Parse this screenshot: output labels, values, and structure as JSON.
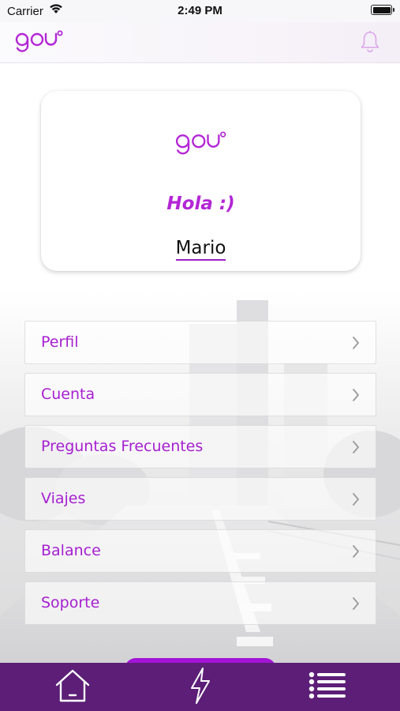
{
  "status_bar": {
    "carrier": "Carrier",
    "time": "2:49 PM"
  },
  "header": {
    "logo_text": "gou",
    "bell_icon": "bell-icon"
  },
  "card": {
    "logo_text": "gou",
    "greeting": "Hola :)",
    "user_name": "Mario"
  },
  "menu": {
    "items": [
      {
        "label": "Perfil"
      },
      {
        "label": "Cuenta"
      },
      {
        "label": "Preguntas Frecuentes"
      },
      {
        "label": "Viajes"
      },
      {
        "label": "Balance"
      },
      {
        "label": "Soporte"
      }
    ]
  },
  "tab_bar": {
    "tabs": [
      {
        "icon": "home-icon"
      },
      {
        "icon": "lightning-icon"
      },
      {
        "icon": "list-menu-icon"
      }
    ]
  },
  "colors": {
    "accent": "#a61fd0",
    "tab_bar": "#5c1e77",
    "fab": "#a214d6"
  }
}
